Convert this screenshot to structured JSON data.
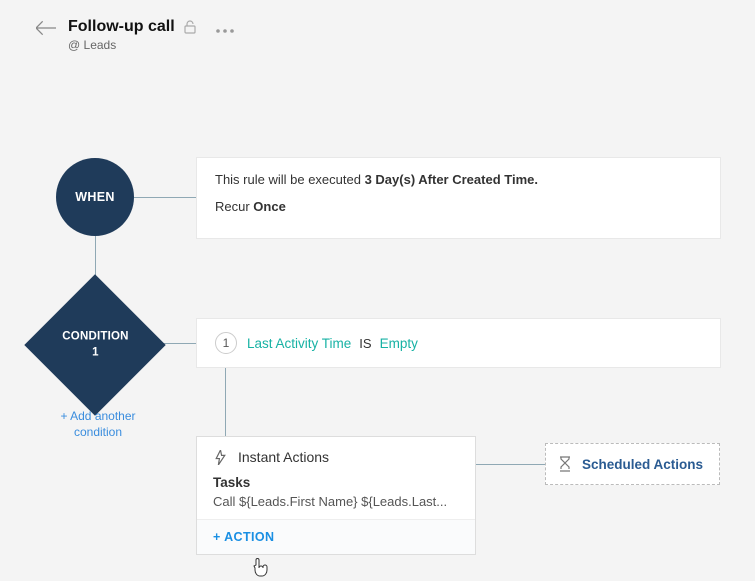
{
  "header": {
    "title": "Follow-up call",
    "subtitle": "@ Leads"
  },
  "when": {
    "label": "WHEN",
    "text_pre": "This rule will be executed ",
    "text_bold": "3 Day(s) After Created Time.",
    "recur_pre": "Recur ",
    "recur_bold": "Once"
  },
  "condition": {
    "label_line1": "CONDITION",
    "label_line2": "1",
    "number": "1",
    "field": "Last Activity Time",
    "op": "IS",
    "value": "Empty",
    "add_another": "+ Add another condition"
  },
  "actions": {
    "instant_title": "Instant Actions",
    "tasks_label": "Tasks",
    "task_item": "Call ${Leads.First Name} ${Leads.Last...",
    "add_action": "+ ACTION",
    "scheduled_title": "Scheduled Actions"
  }
}
